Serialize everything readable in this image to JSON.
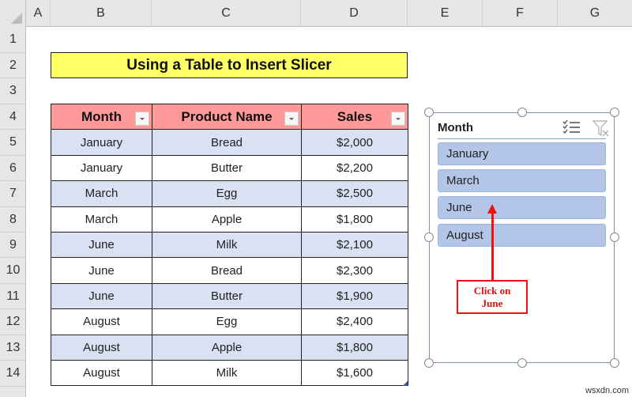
{
  "sheet": {
    "columns": [
      "A",
      "B",
      "C",
      "D",
      "E",
      "F",
      "G"
    ],
    "rows": [
      "1",
      "2",
      "3",
      "4",
      "5",
      "6",
      "7",
      "8",
      "9",
      "10",
      "11",
      "12",
      "13",
      "14"
    ]
  },
  "title": "Using a Table to Insert Slicer",
  "table": {
    "headers": [
      "Month",
      "Product Name",
      "Sales"
    ],
    "rows": [
      [
        "January",
        "Bread",
        "$2,000"
      ],
      [
        "January",
        "Butter",
        "$2,200"
      ],
      [
        "March",
        "Egg",
        "$2,500"
      ],
      [
        "March",
        "Apple",
        "$1,800"
      ],
      [
        "June",
        "Milk",
        "$2,100"
      ],
      [
        "June",
        "Bread",
        "$2,300"
      ],
      [
        "June",
        "Butter",
        "$1,900"
      ],
      [
        "August",
        "Egg",
        "$2,400"
      ],
      [
        "August",
        "Apple",
        "$1,800"
      ],
      [
        "August",
        "Milk",
        "$1,600"
      ]
    ]
  },
  "slicer": {
    "title": "Month",
    "items": [
      "January",
      "March",
      "June",
      "August"
    ],
    "icons": [
      "multi-select-icon",
      "clear-filter-icon"
    ]
  },
  "annotation": {
    "line1": "Click on",
    "line2": "June"
  },
  "colors": {
    "title_fill": "#ffff66",
    "header_fill": "#ff9999",
    "band_fill": "#d9e1f2",
    "slicer_item_fill": "#b4c6e7",
    "annotation_red": "#ee1111"
  },
  "watermark": "wsxdn.com"
}
